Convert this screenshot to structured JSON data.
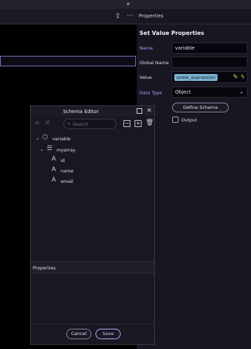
{
  "toolbar": {
    "share_icon": "share-icon",
    "more_icon": "more-horizontal-icon",
    "more_glyph": "···",
    "collapse_glyph": "»"
  },
  "properties_panel": {
    "header": "Properties",
    "title": "Set Value Properties",
    "name_label": "Name",
    "name_value": "variable",
    "global_name_label": "Global Name",
    "global_name_value": "",
    "value_label": "Value",
    "value_expression": "some_expression",
    "data_type_label": "Data Type",
    "data_type_value": "Object",
    "define_schema_label": "Define Schema",
    "output_label": "Output",
    "output_checked": false,
    "accent_color": "#a9a0ff"
  },
  "schema_editor": {
    "title": "Schema Editor",
    "search_placeholder": "Search",
    "tree": [
      {
        "label": "variable",
        "icon": "cube-icon",
        "expanded": true
      },
      {
        "label": "myarray",
        "icon": "list-icon",
        "expanded": true
      },
      {
        "label": "id",
        "icon": "text-type-icon"
      },
      {
        "label": "name",
        "icon": "text-type-icon"
      },
      {
        "label": "email",
        "icon": "text-type-icon"
      }
    ],
    "properties_label": "Properties",
    "cancel_label": "Cancel",
    "save_label": "Save"
  }
}
